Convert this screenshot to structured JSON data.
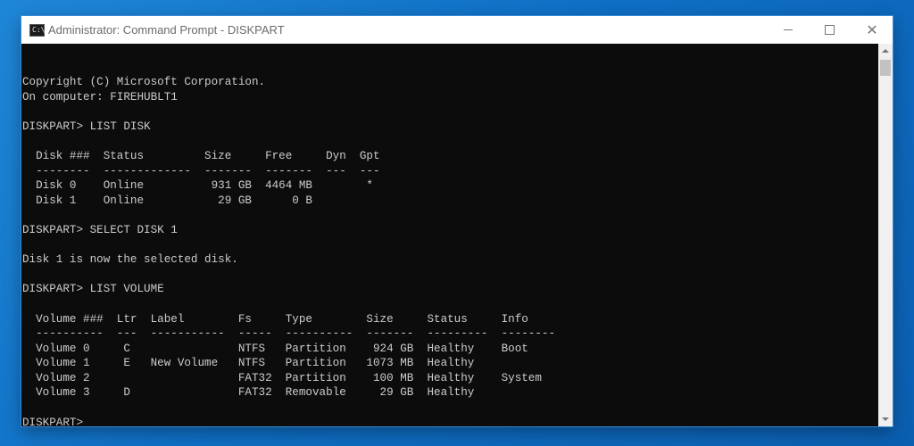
{
  "window": {
    "title": "Administrator: Command Prompt - DISKPART",
    "icon_label": "C:\\"
  },
  "controls": {
    "minimize_icon": "minimize-icon",
    "maximize_icon": "maximize-icon",
    "close_icon": "close-icon",
    "close_glyph": "✕"
  },
  "console": {
    "lines": [
      "Copyright (C) Microsoft Corporation.",
      "On computer: FIREHUBLT1",
      "",
      "DISKPART> LIST DISK",
      "",
      "  Disk ###  Status         Size     Free     Dyn  Gpt",
      "  --------  -------------  -------  -------  ---  ---",
      "  Disk 0    Online          931 GB  4464 MB        *",
      "  Disk 1    Online           29 GB      0 B",
      "",
      "DISKPART> SELECT DISK 1",
      "",
      "Disk 1 is now the selected disk.",
      "",
      "DISKPART> LIST VOLUME",
      "",
      "  Volume ###  Ltr  Label        Fs     Type        Size     Status     Info",
      "  ----------  ---  -----------  -----  ----------  -------  ---------  --------",
      "  Volume 0     C                NTFS   Partition    924 GB  Healthy    Boot",
      "  Volume 1     E   New Volume   NTFS   Partition   1073 MB  Healthy",
      "  Volume 2                      FAT32  Partition    100 MB  Healthy    System",
      "  Volume 3     D                FAT32  Removable     29 GB  Healthy",
      "",
      "DISKPART>"
    ]
  },
  "colors": {
    "console_bg": "#0c0c0c",
    "console_fg": "#cccccc",
    "desktop_accent": "#0f6fc4"
  }
}
